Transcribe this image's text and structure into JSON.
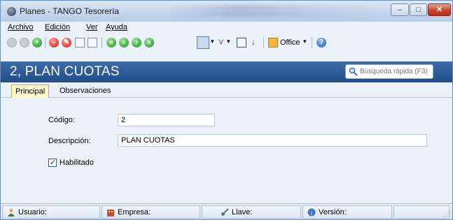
{
  "window": {
    "title": "Planes - TANGO Tesorería",
    "controls": {
      "minimize": "–",
      "maximize": "□",
      "close": "✕"
    }
  },
  "menu": {
    "items": [
      {
        "label": "Archivo"
      },
      {
        "label": "Edición"
      },
      {
        "label": "Ver"
      },
      {
        "label": "Ayuda"
      }
    ]
  },
  "toolbar": {
    "office_label": "Office",
    "icons": [
      "check-icon",
      "cancel-icon",
      "add-icon",
      "delete-icon",
      "edit-icon",
      "import-icon",
      "export-icon",
      "first-icon",
      "previous-icon",
      "next-icon",
      "last-icon",
      "view-icon",
      "filter-icon",
      "columns-icon",
      "sort-icon",
      "office-icon",
      "help-icon"
    ]
  },
  "header": {
    "title": "2, PLAN CUOTAS",
    "search_placeholder": "Búsqueda rápida (F3)"
  },
  "tabs": [
    {
      "label": "Principal",
      "active": true
    },
    {
      "label": "Observaciones",
      "active": false
    }
  ],
  "form": {
    "codigo_label": "Código:",
    "codigo_value": "2",
    "descripcion_label": "Descripción:",
    "descripcion_value": "PLAN CUOTAS",
    "habilitado_label": "Habilitado",
    "habilitado_checked": true
  },
  "statusbar": {
    "usuario_label": "Usuario:",
    "empresa_label": "Empresa:",
    "llave_label": "Llave:",
    "version_label": "Versión:"
  },
  "colors": {
    "header_bg": "#2d5c97",
    "window_bg": "#eaf1f9",
    "active_tab_bg": "#fff6c9",
    "close_button": "#c9452d"
  }
}
